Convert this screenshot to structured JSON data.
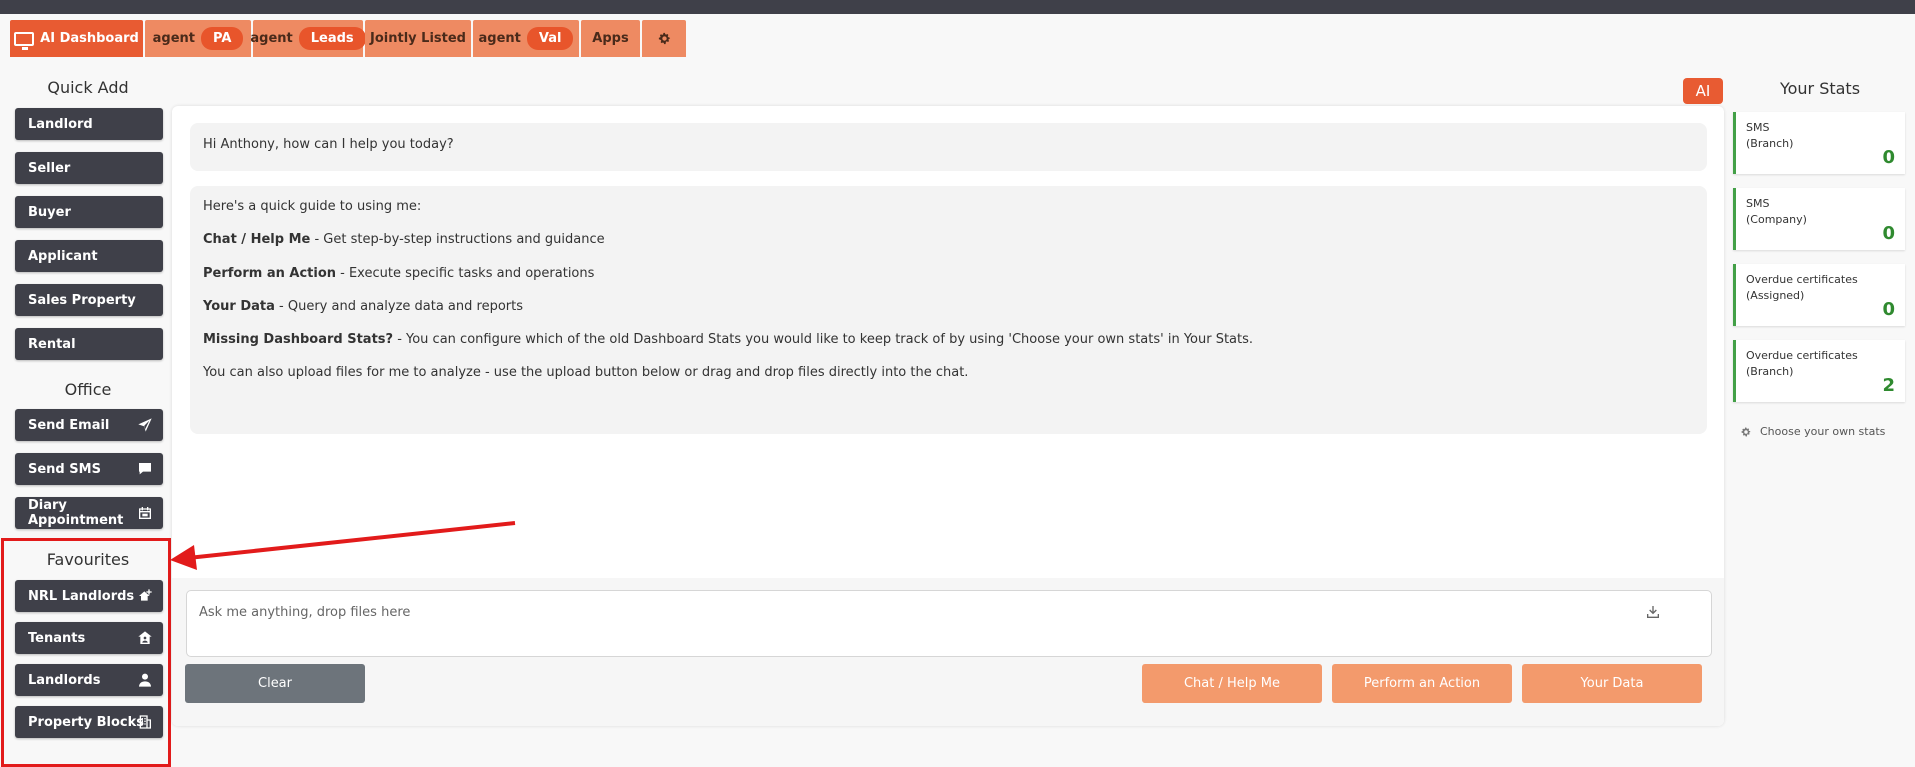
{
  "tabs": [
    {
      "label": "AI Dashboard",
      "pill": null
    },
    {
      "label": "agent",
      "pill": "PA"
    },
    {
      "label": "agent",
      "pill": "Leads"
    },
    {
      "label": "Jointly Listed",
      "pill": null
    },
    {
      "label": "agent",
      "pill": "Val"
    },
    {
      "label": "Apps",
      "pill": null
    }
  ],
  "left": {
    "quick_add_title": "Quick Add",
    "quick_add": [
      "Landlord",
      "Seller",
      "Buyer",
      "Applicant",
      "Sales Property",
      "Rental"
    ],
    "office_title": "Office",
    "office": [
      "Send Email",
      "Send SMS",
      "Diary Appointment"
    ],
    "favourites_title": "Favourites",
    "favourites": [
      "NRL Landlords",
      "Tenants",
      "Landlords",
      "Property Blocks"
    ]
  },
  "chat": {
    "ai_badge": "AI",
    "greeting": "Hi Anthony, how can I help you today?",
    "guide_intro": "Here's a quick guide to using me:",
    "guide": [
      {
        "title": "Chat / Help Me",
        "text": " - Get step-by-step instructions and guidance"
      },
      {
        "title": "Perform an Action",
        "text": " - Execute specific tasks and operations"
      },
      {
        "title": "Your Data",
        "text": " - Query and analyze data and reports"
      },
      {
        "title": "Missing Dashboard Stats?",
        "text": " - You can configure which of the old Dashboard Stats you would like to keep track of by using 'Choose your own stats' in Your Stats."
      }
    ],
    "upload_note": "You can also upload files for me to analyze - use the upload button below or drag and drop files directly into the chat.",
    "input_placeholder": "Ask me anything, drop files here",
    "clear_label": "Clear",
    "actions": [
      "Chat / Help Me",
      "Perform an Action",
      "Your Data"
    ]
  },
  "stats": {
    "title": "Your Stats",
    "cards": [
      {
        "line1": "SMS",
        "line2": "(Branch)",
        "value": "0"
      },
      {
        "line1": "SMS",
        "line2": "(Company)",
        "value": "0"
      },
      {
        "line1": "Overdue certificates",
        "line2": "(Assigned)",
        "value": "0"
      },
      {
        "line1": "Overdue certificates",
        "line2": "(Branch)",
        "value": "2"
      }
    ],
    "choose_label": "Choose your own stats"
  },
  "colors": {
    "accent": "#e85b32",
    "tab_bg": "#ee8a62",
    "dark": "#3f4049",
    "action": "#f39a6c",
    "stat_green": "#43a047",
    "annotation_red": "#e21b1b"
  }
}
